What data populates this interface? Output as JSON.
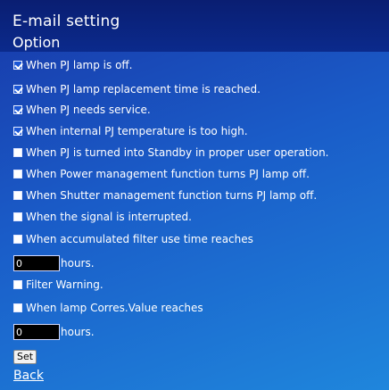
{
  "header": {
    "title": "E-mail setting",
    "subtitle": "Option"
  },
  "options": [
    {
      "label": "When PJ lamp is off.",
      "checked": true
    },
    {
      "label": "When PJ lamp replacement time is reached.",
      "checked": true
    },
    {
      "label": "When PJ needs service.",
      "checked": true
    },
    {
      "label": "When internal PJ temperature is too high.",
      "checked": true
    },
    {
      "label": "When PJ is turned into Standby in proper user operation.",
      "checked": false
    },
    {
      "label": "When Power management function turns PJ lamp off.",
      "checked": false
    },
    {
      "label": "When Shutter management function turns PJ lamp off.",
      "checked": false
    },
    {
      "label": "When the signal is interrupted.",
      "checked": false
    },
    {
      "label": "When accumulated filter use time reaches",
      "checked": false
    }
  ],
  "filter_hours": {
    "value": "0",
    "unit": "hours."
  },
  "filter_warning": {
    "label": "Filter Warning.",
    "checked": false
  },
  "lamp_corres": {
    "label": "When lamp Corres.Value reaches",
    "checked": false
  },
  "lamp_hours": {
    "value": "0",
    "unit": "hours."
  },
  "set_label": "Set",
  "back_label": "Back"
}
